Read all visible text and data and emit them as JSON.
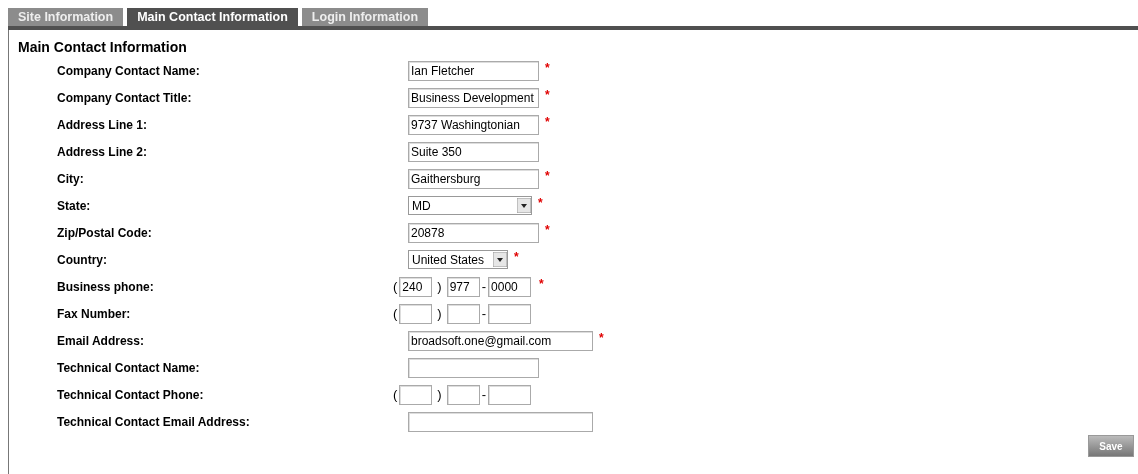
{
  "tabs": [
    {
      "label": "Site Information",
      "selected": false
    },
    {
      "label": "Main Contact Information",
      "selected": true
    },
    {
      "label": "Login Information",
      "selected": false
    }
  ],
  "section": {
    "title": "Main Contact Information"
  },
  "fields": [
    {
      "label": "Company Contact Name:",
      "kind": "text",
      "value": "Ian Fletcher",
      "required_mark": "*"
    },
    {
      "label": "Company Contact Title:",
      "kind": "text",
      "value": "Business Development",
      "required_mark": "*"
    },
    {
      "label": "Address Line 1:",
      "kind": "text",
      "value": "9737 Washingtonian",
      "required_mark": "*"
    },
    {
      "label": "Address Line 2:",
      "kind": "text",
      "value": "Suite 350"
    },
    {
      "label": "City:",
      "kind": "text",
      "value": "Gaithersburg",
      "required_mark": "*"
    },
    {
      "label": "State:",
      "kind": "select",
      "value": "MD",
      "required_mark": "*"
    },
    {
      "label": "Zip/Postal Code:",
      "kind": "text",
      "value": "20878",
      "required_mark": "*"
    },
    {
      "label": "Country:",
      "kind": "select_short",
      "value": "United States",
      "required_mark": "*"
    },
    {
      "label": "Business phone:",
      "kind": "phone",
      "parts": [
        {
          "kind": "sep",
          "text": "("
        },
        {
          "kind": "input",
          "value": "240"
        },
        {
          "kind": "sep",
          "text": ")"
        },
        {
          "kind": "input",
          "value": "977"
        },
        {
          "kind": "sep",
          "text": "-"
        },
        {
          "kind": "input",
          "value": "0000"
        }
      ],
      "required_mark": "*"
    },
    {
      "label": "Fax Number:",
      "kind": "phone",
      "parts": [
        {
          "kind": "sep",
          "text": "("
        },
        {
          "kind": "input"
        },
        {
          "kind": "sep",
          "text": ")"
        },
        {
          "kind": "input"
        },
        {
          "kind": "sep",
          "text": "-"
        },
        {
          "kind": "input"
        }
      ]
    },
    {
      "label": "Email Address:",
      "kind": "email",
      "value": "broadsoft.one@gmail.com",
      "required_mark": "*"
    },
    {
      "label": "Technical Contact Name:",
      "kind": "text"
    },
    {
      "label": "Technical Contact Phone:",
      "kind": "phone",
      "parts": [
        {
          "kind": "sep",
          "text": "("
        },
        {
          "kind": "input"
        },
        {
          "kind": "sep",
          "text": ")"
        },
        {
          "kind": "input"
        },
        {
          "kind": "sep",
          "text": "-"
        },
        {
          "kind": "input"
        }
      ]
    },
    {
      "label": "Technical Contact Email Address:",
      "kind": "email"
    }
  ],
  "save_button": "Save"
}
